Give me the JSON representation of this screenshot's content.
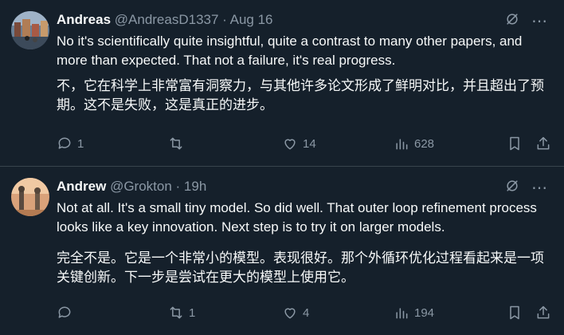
{
  "tweets": [
    {
      "name": "Andreas",
      "handle": "@AndreasD1337 · Aug 16",
      "text_en": "No it's scientifically quite insightful, quite a contrast to many other papers, and more than expected. That not a failure, it's real progress.",
      "text_zh": "不，它在科学上非常富有洞察力，与其他许多论文形成了鲜明对比，并且超出了预期。这不是失败，这是真正的进步。",
      "replies": "1",
      "reposts": "",
      "likes": "14",
      "views": "628"
    },
    {
      "name": "Andrew",
      "handle": "@Grokton · 19h",
      "text_en": "Not at all. It's a small tiny model. So did well. That outer loop refinement process looks like a key innovation. Next step is to try it on larger models.",
      "text_zh": "完全不是。它是一个非常小的模型。表现很好。那个外循环优化过程看起来是一项关键创新。下一步是尝试在更大的模型上使用它。",
      "replies": "",
      "reposts": "1",
      "likes": "4",
      "views": "194"
    }
  ],
  "icons": [
    "grok-icon",
    "more-icon",
    "reply-icon",
    "repost-icon",
    "like-icon",
    "views-icon",
    "bookmark-icon",
    "share-icon"
  ],
  "colors": {
    "background": "#15202b",
    "text": "#f7f9f9",
    "muted": "#8b98a5",
    "divider": "#38444d"
  }
}
